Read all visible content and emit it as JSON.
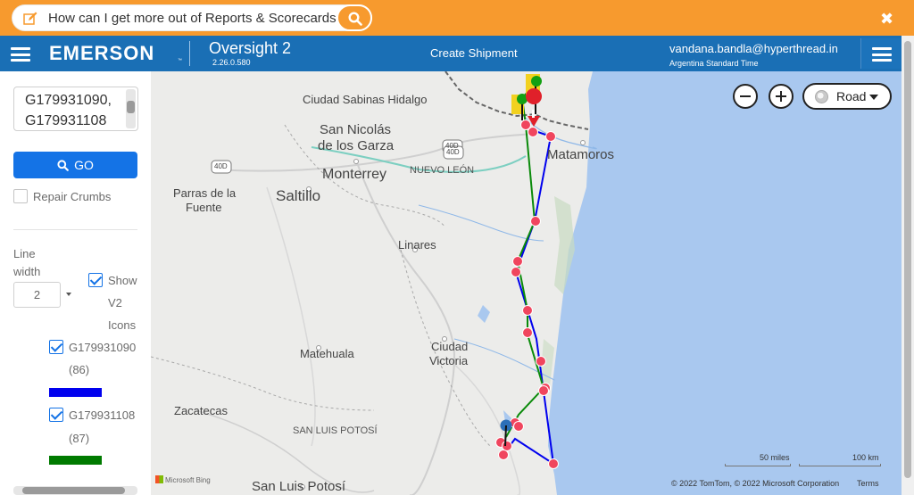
{
  "feedback": {
    "question": "How can I get more out of Reports & Scorecards?",
    "close_label": "✖"
  },
  "nav": {
    "logo": "EMERSON",
    "logo_tm": "™",
    "app_name": "Oversight 2",
    "app_version": "2.26.0.580",
    "create_shipment": "Create Shipment",
    "user_email": "vandana.bandla@hyperthread.in",
    "timezone": "Argentina Standard Time"
  },
  "sidebar": {
    "shipment_ids_line1": "G179931090,",
    "shipment_ids_line2": "G179931108",
    "go_label": "GO",
    "repair_crumbs_label": "Repair Crumbs",
    "repair_crumbs_checked": false,
    "line_width_label_1": "Line",
    "line_width_label_2": "width",
    "line_width_value": "2",
    "show_v2_label_1": "Show",
    "show_v2_label_2": "V2",
    "show_v2_label_3": "Icons",
    "show_v2_checked": true,
    "shipments": [
      {
        "id": "G179931090",
        "count": "(86)",
        "color": "#0000ee",
        "checked": true
      },
      {
        "id": "G179931108",
        "count": "(87)",
        "color": "#007a00",
        "checked": true
      }
    ]
  },
  "map": {
    "style_label": "Road",
    "zoom_out_label": "−",
    "zoom_in_label": "+",
    "labels": {
      "sabinas": "Ciudad Sabinas Hidalgo",
      "nicolas1": "San Nicolás",
      "nicolas2": "de los Garza",
      "monterrey": "Monterrey",
      "nuevo_leon": "NUEVO LEÓN",
      "matamoros": "Matamoros",
      "parras1": "Parras de la",
      "parras2": "Fuente",
      "saltillo": "Saltillo",
      "linares": "Linares",
      "cv1": "Ciudad",
      "cv2": "Victoria",
      "matehuala": "Matehuala",
      "zacatecas": "Zacatecas",
      "slp_state": "SAN LUIS POTOSÍ",
      "slp_city": "San Luis Potosí",
      "hwy_40d_a": "40D",
      "hwy_40d_b": "40D",
      "hwy_40d_c": "40D"
    },
    "scale_miles": "50 miles",
    "scale_km": "100 km",
    "copyright": "© 2022 TomTom, © 2022 Microsoft Corporation",
    "terms": "Terms",
    "bing": "Microsoft Bing",
    "colors": {
      "water": "#a9c8ef",
      "land": "#ececea",
      "route_blue": "#0000ee",
      "route_green": "#0a8a0a",
      "crumb": "#f0455e"
    }
  }
}
